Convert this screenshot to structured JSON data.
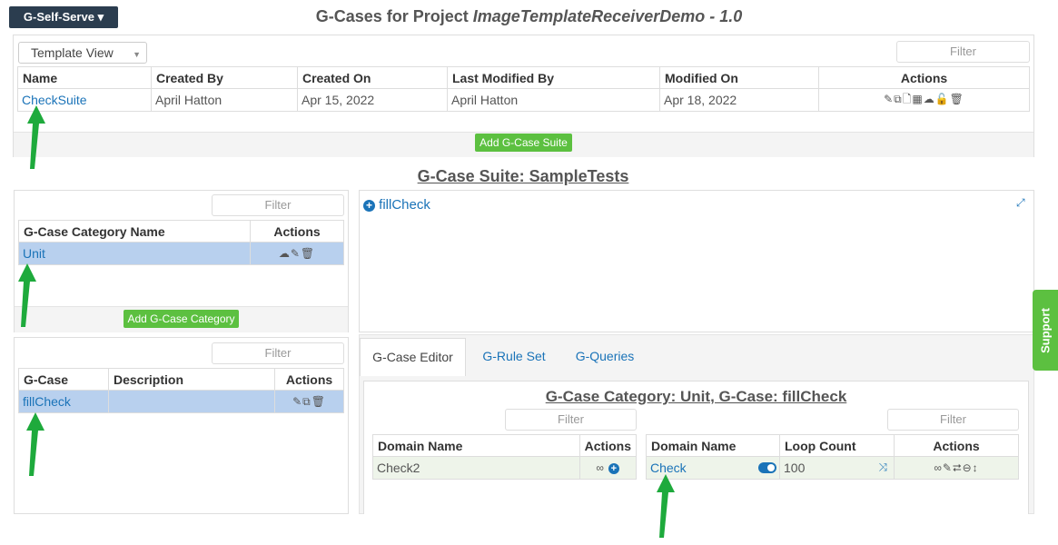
{
  "brand": {
    "label": "G-Self-Serve",
    "caret": "▾"
  },
  "page": {
    "title_prefix": "G-Cases for Project ",
    "title_project": "ImageTemplateReceiverDemo - 1.0"
  },
  "suites": {
    "view_select": "Template View",
    "filter_placeholder": "Filter",
    "columns": [
      "Name",
      "Created By",
      "Created On",
      "Last Modified By",
      "Modified On",
      "Actions"
    ],
    "rows": [
      {
        "name": "CheckSuite",
        "created_by": "April Hatton",
        "created_on": "Apr 15, 2022",
        "last_modified_by": "April Hatton",
        "modified_on": "Apr 18, 2022"
      }
    ],
    "add_button": "Add G-Case Suite"
  },
  "suite_title": "G-Case Suite: SampleTests",
  "categories": {
    "filter_placeholder": "Filter",
    "columns": [
      "G-Case Category Name",
      "Actions"
    ],
    "rows": [
      {
        "name": "Unit"
      }
    ],
    "add_button": "Add G-Case Category"
  },
  "cases": {
    "filter_placeholder": "Filter",
    "columns": [
      "G-Case",
      "Description",
      "Actions"
    ],
    "rows": [
      {
        "name": "fillCheck",
        "description": ""
      }
    ]
  },
  "tree": {
    "node_label": "fillCheck"
  },
  "tabs": [
    "G-Case Editor",
    "G-Rule Set",
    "G-Queries"
  ],
  "editor": {
    "title": "G-Case Category: Unit, G-Case: fillCheck",
    "left_filter": "Filter",
    "right_filter": "Filter",
    "left_columns": [
      "Domain Name",
      "Actions"
    ],
    "left_rows": [
      {
        "name": "Check2"
      }
    ],
    "right_columns": [
      "Domain Name",
      "Loop Count",
      "Actions"
    ],
    "right_rows": [
      {
        "name": "Check",
        "loop_count": "100"
      }
    ]
  },
  "support": {
    "label": "Support"
  },
  "colors": {
    "accent": "#1a73b8",
    "green": "#5cc040",
    "brand_bg": "#2b3d4f",
    "selected_row": "#b8d0ee"
  }
}
